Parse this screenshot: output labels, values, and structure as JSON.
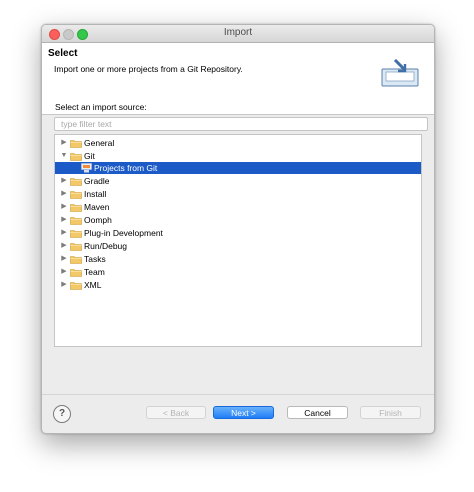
{
  "window": {
    "title": "Import"
  },
  "header": {
    "title": "Select",
    "description": "Import one or more projects from a Git Repository."
  },
  "source": {
    "label": "Select an import source:",
    "filter_placeholder": "type filter text",
    "filter_value": ""
  },
  "tree": {
    "items": [
      {
        "label": "General",
        "expanded": false,
        "level": 0,
        "selected": false
      },
      {
        "label": "Git",
        "expanded": true,
        "level": 0,
        "selected": false
      },
      {
        "label": "Projects from Git",
        "level": 1,
        "selected": true
      },
      {
        "label": "Gradle",
        "expanded": false,
        "level": 0,
        "selected": false
      },
      {
        "label": "Install",
        "expanded": false,
        "level": 0,
        "selected": false
      },
      {
        "label": "Maven",
        "expanded": false,
        "level": 0,
        "selected": false
      },
      {
        "label": "Oomph",
        "expanded": false,
        "level": 0,
        "selected": false
      },
      {
        "label": "Plug-in Development",
        "expanded": false,
        "level": 0,
        "selected": false
      },
      {
        "label": "Run/Debug",
        "expanded": false,
        "level": 0,
        "selected": false
      },
      {
        "label": "Tasks",
        "expanded": false,
        "level": 0,
        "selected": false
      },
      {
        "label": "Team",
        "expanded": false,
        "level": 0,
        "selected": false
      },
      {
        "label": "XML",
        "expanded": false,
        "level": 0,
        "selected": false
      }
    ]
  },
  "footer": {
    "help_label": "?",
    "back_label": "< Back",
    "next_label": "Next >",
    "cancel_label": "Cancel",
    "finish_label": "Finish"
  },
  "colors": {
    "selection": "#1c5bc7",
    "folder": "#f2c869",
    "default_button": "#1f7ef7"
  }
}
